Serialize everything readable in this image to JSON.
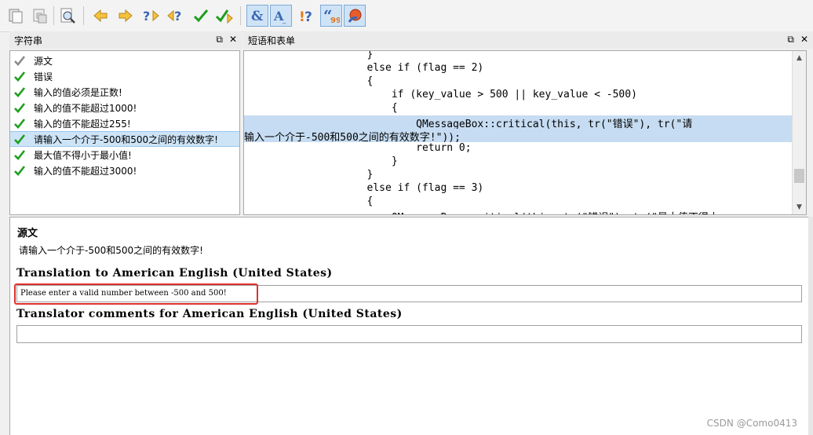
{
  "toolbar": {
    "buttons": [
      "open-file-icon",
      "save-icon",
      "find-icon",
      "prev-icon",
      "next-icon",
      "prev-unfinished-icon",
      "next-unfinished-icon",
      "done-icon",
      "done-next-icon",
      "accelerator-icon",
      "phrase-icon",
      "punctuation-icon",
      "phrase-match-icon",
      "translation-icon"
    ]
  },
  "strings_panel": {
    "title": "字符串",
    "items": [
      {
        "label": "源文",
        "state": "done-gray"
      },
      {
        "label": "错误",
        "state": "done"
      },
      {
        "label": "输入的值必须是正数!",
        "state": "done"
      },
      {
        "label": "输入的值不能超过1000!",
        "state": "done"
      },
      {
        "label": "输入的值不能超过255!",
        "state": "done"
      },
      {
        "label": "请输入一个介于-500和500之间的有效数字!",
        "state": "done"
      },
      {
        "label": "最大值不得小于最小值!",
        "state": "done"
      },
      {
        "label": "输入的值不能超过3000!",
        "state": "done"
      }
    ]
  },
  "phrases_panel": {
    "title": "短语和表单",
    "lines": [
      "                    }",
      "                    else if (flag == 2)",
      "                    {",
      "                        if (key_value > 500 || key_value < -500)",
      "                        {",
      "                            QMessageBox::critical(this, tr(\"错误\"), tr(\"请",
      "输入一个介于-500和500之间的有效数字!\"));",
      "                            return 0;",
      "                        }",
      "                    }",
      "                    else if (flag == 3)",
      "                    {",
      "                        QMessageBox::critical(this, tr(\"错误\"), tr(\"最大值不得小"
    ]
  },
  "editor": {
    "source_label": "源文",
    "source_text": "请输入一个介于-500和500之间的有效数字!",
    "translation_label": "Translation to American English (United States)",
    "translation_value": "Please enter a valid number between -500 and 500!",
    "comments_label": "Translator comments for American English (United States)",
    "comments_value": ""
  },
  "panel_buttons": {
    "float": "⧉",
    "close": "✕"
  },
  "watermark": "CSDN @Como0413",
  "colors": {
    "check_green": "#1e9e1e",
    "highlight": "#c6dcf2",
    "selection": "#cde4f7",
    "red_box": "#e0302e"
  }
}
